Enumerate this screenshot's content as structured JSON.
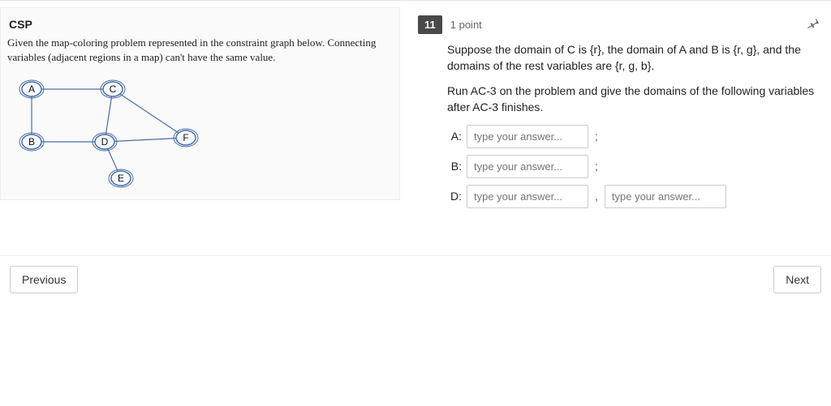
{
  "left": {
    "title": "CSP",
    "description": "Given the map-coloring problem represented in the constraint graph below. Connecting variables (adjacent regions in a map) can't have the same value.",
    "graph": {
      "nodes": {
        "A": "A",
        "B": "B",
        "C": "C",
        "D": "D",
        "E": "E",
        "F": "F"
      }
    }
  },
  "question": {
    "number": "11",
    "points": "1 point",
    "para1": "Suppose the domain of C is {r}, the domain of A and B is {r, g}, and the domains of the rest variables are {r, g, b}.",
    "para2": "Run AC-3 on the problem and give the domains of the following variables after AC-3 finishes.",
    "answers": {
      "A": {
        "label": "A:",
        "placeholder": "type your answer..."
      },
      "B": {
        "label": "B:",
        "placeholder": "type your answer..."
      },
      "D": {
        "label": "D:",
        "placeholder": "type your answer..."
      }
    },
    "extra_placeholder": "type your answer...",
    "sep": ";",
    "comma": ","
  },
  "nav": {
    "prev": "Previous",
    "next": "Next"
  }
}
